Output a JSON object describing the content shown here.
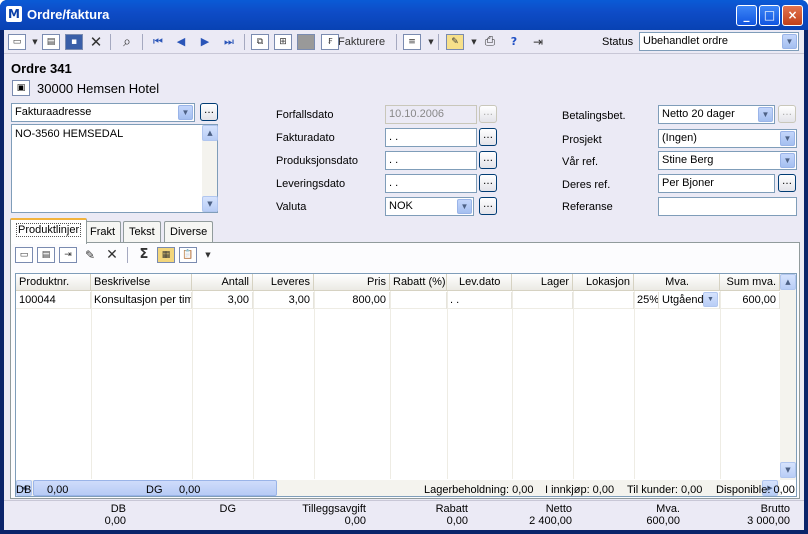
{
  "window": {
    "title": "Ordre/faktura",
    "minimize": "_",
    "maximize": "□",
    "close": "×"
  },
  "toolbar": {
    "fakturere_label": "Fakturere",
    "status_label": "Status",
    "status_value": "Ubehandlet ordre"
  },
  "order": {
    "title": "Ordre 341",
    "customer": "30000 Hemsen Hotel"
  },
  "address": {
    "type": "Fakturaadresse",
    "text": "NO-3560 HEMSEDAL"
  },
  "dates": {
    "forfallsdato_label": "Forfallsdato",
    "forfallsdato_value": "10.10.2006",
    "fakturadato_label": "Fakturadato",
    "fakturadato_value": "  .  .",
    "produksjonsdato_label": "Produksjonsdato",
    "produksjonsdato_value": "  .  .",
    "leveringsdato_label": "Leveringsdato",
    "leveringsdato_value": "  .  .",
    "valuta_label": "Valuta",
    "valuta_value": "NOK"
  },
  "right": {
    "betalingsbet_label": "Betalingsbet.",
    "betalingsbet_value": "Netto 20 dager",
    "prosjekt_label": "Prosjekt",
    "prosjekt_value": "(Ingen)",
    "vaar_ref_label": "Vår ref.",
    "vaar_ref_value": "Stine Berg",
    "deres_ref_label": "Deres ref.",
    "deres_ref_value": "Per Bjoner",
    "referanse_label": "Referanse",
    "referanse_value": ""
  },
  "tabs": [
    "Produktlinjer",
    "Frakt",
    "Tekst",
    "Diverse"
  ],
  "grid": {
    "columns": [
      "Produktnr.",
      "Beskrivelse",
      "Antall",
      "Leveres",
      "Pris",
      "Rabatt (%)",
      "Lev.dato",
      "Lager",
      "Lokasjon",
      "Mva.",
      "Sum mva."
    ],
    "rows": [
      {
        "produktnr": "100044",
        "beskrivelse": "Konsultasjon per time",
        "antall": "3,00",
        "leveres": "3,00",
        "pris": "800,00",
        "rabatt": "",
        "levdato": " .  .",
        "lager": "",
        "lokasjon": "",
        "mva_pct": "25%",
        "mva_code": "Utgående",
        "sum": "600,00"
      }
    ]
  },
  "status": {
    "db_label": "DB",
    "db_value": "0,00",
    "dg_label": "DG",
    "dg_value": "0,00",
    "lager": "Lagerbeholdning: 0,00",
    "innkjop": "I innkjøp: 0,00",
    "kunder": "Til kunder: 0,00",
    "disponible": "Disponible: 0,00"
  },
  "totals": {
    "db_label": "DB",
    "db_value": "0,00",
    "dg_label": "DG",
    "dg_value": "",
    "tillegg_label": "Tilleggsavgift",
    "tillegg_value": "0,00",
    "rabatt_label": "Rabatt",
    "rabatt_value": "0,00",
    "netto_label": "Netto",
    "netto_value": "2 400,00",
    "mva_label": "Mva.",
    "mva_value": "600,00",
    "brutto_label": "Brutto",
    "brutto_value": "3 000,00"
  }
}
